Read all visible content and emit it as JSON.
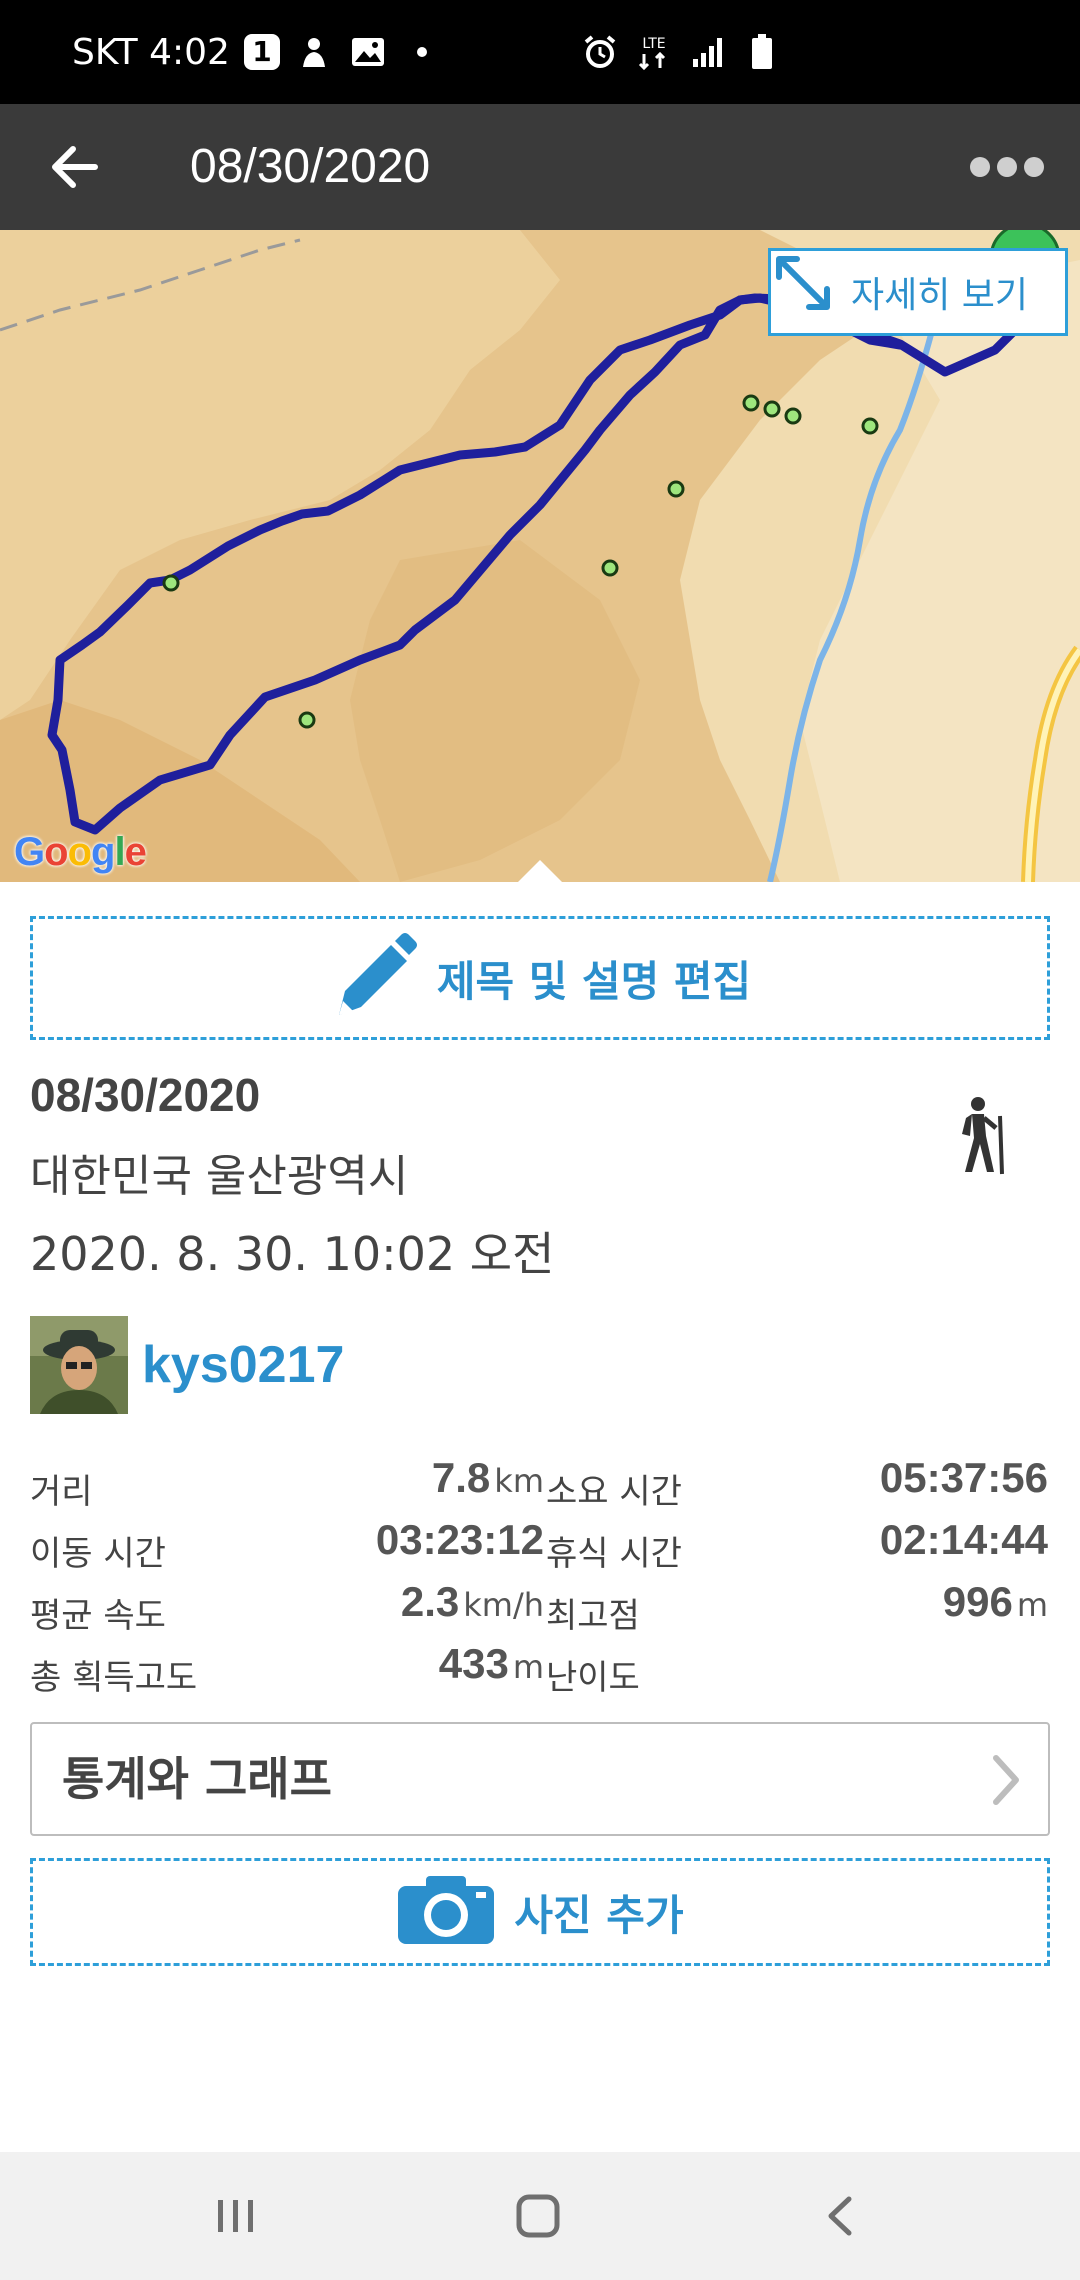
{
  "status_bar": {
    "carrier_time": "SKT 4:02",
    "notification_count": "1",
    "network": "LTE",
    "icons": [
      "notification-badge-icon",
      "person-icon",
      "image-icon",
      "dot-icon",
      "alarm-icon",
      "lte-icon",
      "signal-icon",
      "battery-icon"
    ]
  },
  "app_bar": {
    "title": "08/30/2020",
    "back_icon": "arrow-left-icon",
    "more_icon": "more-dots-icon"
  },
  "map": {
    "expand_label": "자세히 보기",
    "expand_icon": "expand-arrows-icon",
    "attribution": "Google",
    "route_color": "#1f1f9c",
    "waypoint_color": "#9ee67d"
  },
  "edit_button": {
    "label": "제목 및 설명 편집",
    "icon": "pencil-icon"
  },
  "activity": {
    "title": "08/30/2020",
    "location": "대한민국 울산광역시",
    "datetime": "2020. 8. 30. 10:02 오전",
    "type_icon": "hiking-icon"
  },
  "user": {
    "username": "kys0217",
    "avatar_icon": "user-avatar"
  },
  "stats": {
    "distance": {
      "label": "거리",
      "value": "7.8",
      "unit": "km"
    },
    "total_time": {
      "label": "소요 시간",
      "value": "05:37:56"
    },
    "moving_time": {
      "label": "이동 시간",
      "value": "03:23:12"
    },
    "rest_time": {
      "label": "휴식 시간",
      "value": "02:14:44"
    },
    "avg_speed": {
      "label": "평균 속도",
      "value": "2.3",
      "unit": "km/h"
    },
    "max_elevation": {
      "label": "최고점",
      "value": "996",
      "unit": "m"
    },
    "elevation_gain": {
      "label": "총 획득고도",
      "value": "433",
      "unit": "m"
    },
    "difficulty": {
      "label": "난이도",
      "value": ""
    }
  },
  "graph_button": {
    "label": "통계와 그래프",
    "icon": "chevron-right-icon"
  },
  "photo_button": {
    "label": "사진 추가",
    "icon": "camera-icon"
  },
  "nav_bar": {
    "icons": [
      "recent-apps-icon",
      "home-icon",
      "back-icon"
    ]
  },
  "colors": {
    "accent": "#2b8fcc",
    "app_bar": "#3a3a3a",
    "status_bar": "#000000"
  }
}
